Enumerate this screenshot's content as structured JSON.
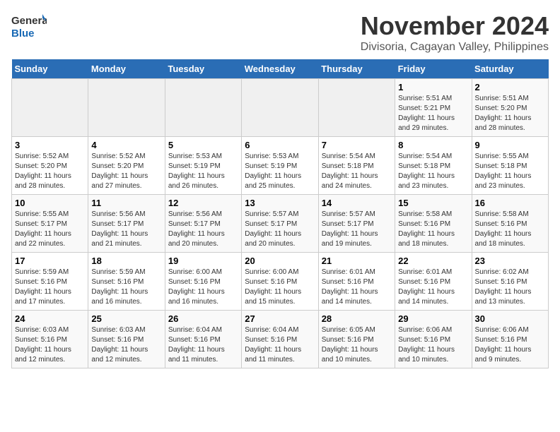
{
  "logo": {
    "line1": "General",
    "line2": "Blue"
  },
  "title": "November 2024",
  "location": "Divisoria, Cagayan Valley, Philippines",
  "weekdays": [
    "Sunday",
    "Monday",
    "Tuesday",
    "Wednesday",
    "Thursday",
    "Friday",
    "Saturday"
  ],
  "weeks": [
    [
      {
        "day": "",
        "info": ""
      },
      {
        "day": "",
        "info": ""
      },
      {
        "day": "",
        "info": ""
      },
      {
        "day": "",
        "info": ""
      },
      {
        "day": "",
        "info": ""
      },
      {
        "day": "1",
        "info": "Sunrise: 5:51 AM\nSunset: 5:21 PM\nDaylight: 11 hours\nand 29 minutes."
      },
      {
        "day": "2",
        "info": "Sunrise: 5:51 AM\nSunset: 5:20 PM\nDaylight: 11 hours\nand 28 minutes."
      }
    ],
    [
      {
        "day": "3",
        "info": "Sunrise: 5:52 AM\nSunset: 5:20 PM\nDaylight: 11 hours\nand 28 minutes."
      },
      {
        "day": "4",
        "info": "Sunrise: 5:52 AM\nSunset: 5:20 PM\nDaylight: 11 hours\nand 27 minutes."
      },
      {
        "day": "5",
        "info": "Sunrise: 5:53 AM\nSunset: 5:19 PM\nDaylight: 11 hours\nand 26 minutes."
      },
      {
        "day": "6",
        "info": "Sunrise: 5:53 AM\nSunset: 5:19 PM\nDaylight: 11 hours\nand 25 minutes."
      },
      {
        "day": "7",
        "info": "Sunrise: 5:54 AM\nSunset: 5:18 PM\nDaylight: 11 hours\nand 24 minutes."
      },
      {
        "day": "8",
        "info": "Sunrise: 5:54 AM\nSunset: 5:18 PM\nDaylight: 11 hours\nand 23 minutes."
      },
      {
        "day": "9",
        "info": "Sunrise: 5:55 AM\nSunset: 5:18 PM\nDaylight: 11 hours\nand 23 minutes."
      }
    ],
    [
      {
        "day": "10",
        "info": "Sunrise: 5:55 AM\nSunset: 5:17 PM\nDaylight: 11 hours\nand 22 minutes."
      },
      {
        "day": "11",
        "info": "Sunrise: 5:56 AM\nSunset: 5:17 PM\nDaylight: 11 hours\nand 21 minutes."
      },
      {
        "day": "12",
        "info": "Sunrise: 5:56 AM\nSunset: 5:17 PM\nDaylight: 11 hours\nand 20 minutes."
      },
      {
        "day": "13",
        "info": "Sunrise: 5:57 AM\nSunset: 5:17 PM\nDaylight: 11 hours\nand 20 minutes."
      },
      {
        "day": "14",
        "info": "Sunrise: 5:57 AM\nSunset: 5:17 PM\nDaylight: 11 hours\nand 19 minutes."
      },
      {
        "day": "15",
        "info": "Sunrise: 5:58 AM\nSunset: 5:16 PM\nDaylight: 11 hours\nand 18 minutes."
      },
      {
        "day": "16",
        "info": "Sunrise: 5:58 AM\nSunset: 5:16 PM\nDaylight: 11 hours\nand 18 minutes."
      }
    ],
    [
      {
        "day": "17",
        "info": "Sunrise: 5:59 AM\nSunset: 5:16 PM\nDaylight: 11 hours\nand 17 minutes."
      },
      {
        "day": "18",
        "info": "Sunrise: 5:59 AM\nSunset: 5:16 PM\nDaylight: 11 hours\nand 16 minutes."
      },
      {
        "day": "19",
        "info": "Sunrise: 6:00 AM\nSunset: 5:16 PM\nDaylight: 11 hours\nand 16 minutes."
      },
      {
        "day": "20",
        "info": "Sunrise: 6:00 AM\nSunset: 5:16 PM\nDaylight: 11 hours\nand 15 minutes."
      },
      {
        "day": "21",
        "info": "Sunrise: 6:01 AM\nSunset: 5:16 PM\nDaylight: 11 hours\nand 14 minutes."
      },
      {
        "day": "22",
        "info": "Sunrise: 6:01 AM\nSunset: 5:16 PM\nDaylight: 11 hours\nand 14 minutes."
      },
      {
        "day": "23",
        "info": "Sunrise: 6:02 AM\nSunset: 5:16 PM\nDaylight: 11 hours\nand 13 minutes."
      }
    ],
    [
      {
        "day": "24",
        "info": "Sunrise: 6:03 AM\nSunset: 5:16 PM\nDaylight: 11 hours\nand 12 minutes."
      },
      {
        "day": "25",
        "info": "Sunrise: 6:03 AM\nSunset: 5:16 PM\nDaylight: 11 hours\nand 12 minutes."
      },
      {
        "day": "26",
        "info": "Sunrise: 6:04 AM\nSunset: 5:16 PM\nDaylight: 11 hours\nand 11 minutes."
      },
      {
        "day": "27",
        "info": "Sunrise: 6:04 AM\nSunset: 5:16 PM\nDaylight: 11 hours\nand 11 minutes."
      },
      {
        "day": "28",
        "info": "Sunrise: 6:05 AM\nSunset: 5:16 PM\nDaylight: 11 hours\nand 10 minutes."
      },
      {
        "day": "29",
        "info": "Sunrise: 6:06 AM\nSunset: 5:16 PM\nDaylight: 11 hours\nand 10 minutes."
      },
      {
        "day": "30",
        "info": "Sunrise: 6:06 AM\nSunset: 5:16 PM\nDaylight: 11 hours\nand 9 minutes."
      }
    ]
  ]
}
